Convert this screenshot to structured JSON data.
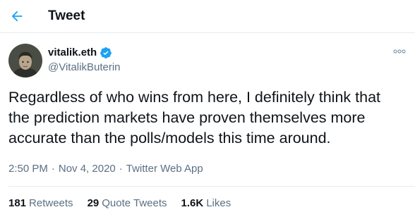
{
  "header": {
    "title": "Tweet"
  },
  "tweet": {
    "author": {
      "name": "vitalik.eth",
      "handle": "@VitalikButerin",
      "verified": true
    },
    "text": "Regardless of who wins from here, I definitely think that\nthe prediction markets have proven themselves more\naccurate than the polls/models this time around.",
    "time": "2:50 PM",
    "date": "Nov 4, 2020",
    "source": "Twitter Web App",
    "stats": {
      "retweets": {
        "count": "181",
        "label": "Retweets"
      },
      "quote_tweets": {
        "count": "29",
        "label": "Quote Tweets"
      },
      "likes": {
        "count": "1.6K",
        "label": "Likes"
      }
    }
  },
  "icons": {
    "back": "arrow-left-icon",
    "verified": "verified-badge-icon",
    "more": "more-options-icon"
  },
  "colors": {
    "accent": "#1da1f2",
    "text_primary": "#0f1419",
    "text_secondary": "#5b7083",
    "divider": "#e6ecf0"
  }
}
